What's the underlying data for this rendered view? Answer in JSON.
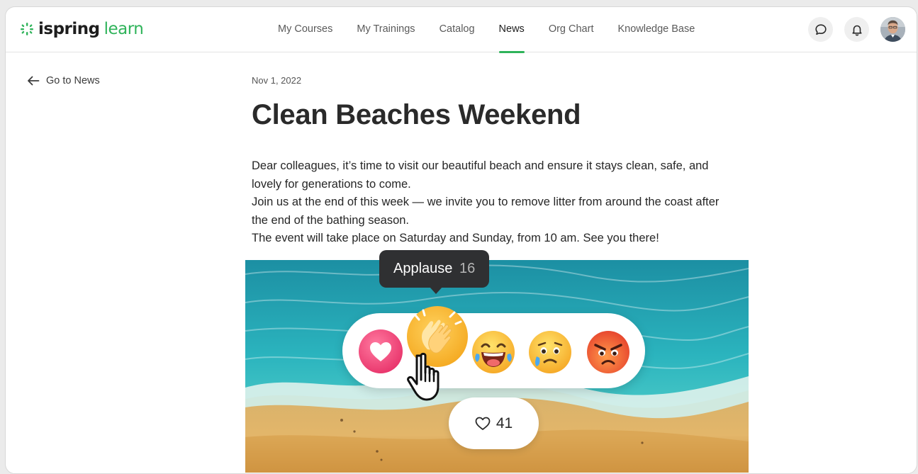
{
  "app": {
    "logo_word1": "ispring",
    "logo_word2": "learn",
    "brand_color": "#2fb35a"
  },
  "nav": {
    "items": [
      {
        "label": "My Courses",
        "active": false
      },
      {
        "label": "My Trainings",
        "active": false
      },
      {
        "label": "Catalog",
        "active": false
      },
      {
        "label": "News",
        "active": true
      },
      {
        "label": "Org Chart",
        "active": false
      },
      {
        "label": "Knowledge Base",
        "active": false
      }
    ]
  },
  "header_icons": [
    "chat-icon",
    "bell-icon",
    "user-avatar"
  ],
  "back_link": {
    "label": "Go to News",
    "icon": "arrow-left-icon"
  },
  "article": {
    "date": "Nov 1, 2022",
    "title": "Clean Beaches Weekend",
    "paragraphs": [
      "Dear colleagues, it’s time to visit our beautiful beach and ensure it stays clean, safe, and",
      "lovely for generations to come.",
      "Join us at the end of this week — we invite you to remove litter from around the coast after",
      "the end of the bathing season.",
      "The event will take place on Saturday and Sunday, from 10 am. See you there!"
    ]
  },
  "tooltip": {
    "label": "Applause",
    "count": "16"
  },
  "reactions": [
    {
      "name": "heart",
      "icon": "heart-icon",
      "color": "#f0457a"
    },
    {
      "name": "applause",
      "icon": "applause-icon",
      "color": "#f7b52c",
      "hovered": true
    },
    {
      "name": "laugh",
      "icon": "laughing-emoji-icon",
      "color": "#f9c23c"
    },
    {
      "name": "sad",
      "icon": "sad-emoji-icon",
      "color": "#f9c23c"
    },
    {
      "name": "angry",
      "icon": "angry-emoji-icon",
      "color": "#e8442d"
    }
  ],
  "likes": {
    "icon": "heart-outline-icon",
    "count": "41"
  }
}
